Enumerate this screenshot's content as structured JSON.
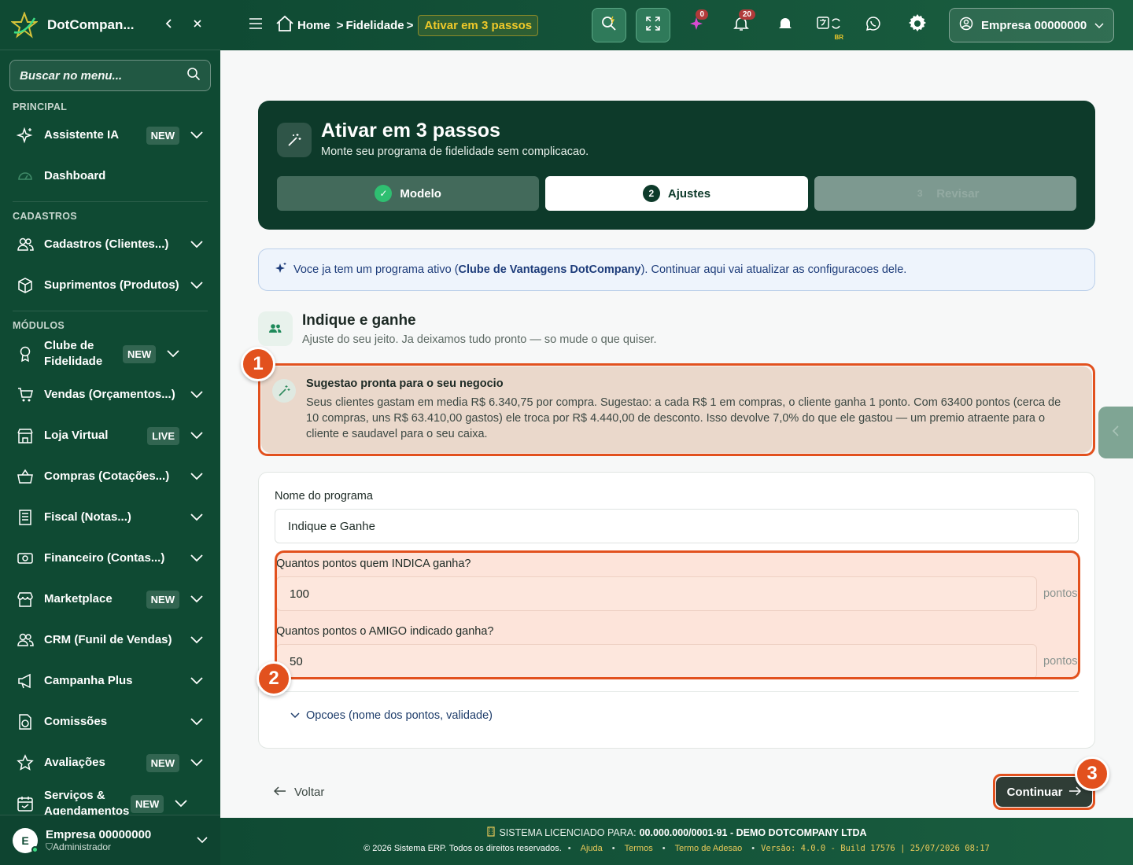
{
  "sidebar": {
    "brand": "DotCompan...",
    "search_placeholder": "Buscar no menu...",
    "sections": {
      "principal": "PRINCIPAL",
      "cadastros": "CADASTROS",
      "modulos": "MÓDULOS"
    },
    "items": [
      {
        "label": "Assistente IA",
        "badge": "NEW",
        "icon": "sparkle-icon"
      },
      {
        "label": "Dashboard",
        "badge": "",
        "icon": "gauge-icon"
      },
      {
        "label": "Cadastros (Clientes...)",
        "badge": "",
        "icon": "users-icon"
      },
      {
        "label": "Suprimentos (Produtos)",
        "badge": "",
        "icon": "box-icon"
      },
      {
        "label": "Clube de Fidelidade",
        "badge": "NEW",
        "icon": "award-icon"
      },
      {
        "label": "Vendas (Orçamentos...)",
        "badge": "",
        "icon": "cart-icon"
      },
      {
        "label": "Loja Virtual",
        "badge": "LIVE",
        "icon": "store-icon"
      },
      {
        "label": "Compras (Cotações...)",
        "badge": "",
        "icon": "basket-icon"
      },
      {
        "label": "Fiscal (Notas...)",
        "badge": "",
        "icon": "document-icon"
      },
      {
        "label": "Financeiro (Contas...)",
        "badge": "",
        "icon": "cash-icon"
      },
      {
        "label": "Marketplace",
        "badge": "NEW",
        "icon": "shop-icon"
      },
      {
        "label": "CRM (Funil de Vendas)",
        "badge": "",
        "icon": "people-icon"
      },
      {
        "label": "Campanha Plus",
        "badge": "",
        "icon": "megaphone-icon"
      },
      {
        "label": "Comissões",
        "badge": "",
        "icon": "commission-icon"
      },
      {
        "label": "Avaliações",
        "badge": "NEW",
        "icon": "star-icon"
      },
      {
        "label": "Serviços & Agendamentos",
        "badge": "NEW",
        "icon": "calendar-icon"
      }
    ],
    "user": {
      "initial": "E",
      "name": "Empresa 00000000",
      "role": "Administrador"
    }
  },
  "header": {
    "breadcrumb": [
      "Home",
      "Fidelidade",
      "Ativar em 3 passos"
    ],
    "notif_counts": {
      "ai": "0",
      "bell": "20"
    },
    "flag_label": "BR",
    "company": "Empresa 00000000"
  },
  "hero": {
    "title": "Ativar em 3 passos",
    "subtitle": "Monte seu programa de fidelidade sem complicacao.",
    "steps": [
      {
        "num": "✓",
        "label": "Modelo",
        "state": "done"
      },
      {
        "num": "2",
        "label": "Ajustes",
        "state": "current"
      },
      {
        "num": "3",
        "label": "Revisar",
        "state": "next"
      }
    ]
  },
  "info": {
    "prefix": "Voce ja tem um programa ativo (",
    "program": "Clube de Vantagens DotCompany",
    "suffix": "). Continuar aqui vai atualizar as configuracoes dele."
  },
  "section": {
    "title": "Indique e ganhe",
    "subtitle": "Ajuste do seu jeito. Ja deixamos tudo pronto — so mude o que quiser."
  },
  "suggestion": {
    "title": "Sugestao pronta para o seu negocio",
    "text": "Seus clientes gastam em media R$ 6.340,75 por compra. Sugestao: a cada R$ 1 em compras, o cliente ganha 1 ponto. Com 63400 pontos (cerca de 10 compras, uns R$ 63.410,00 gastos) ele troca por R$ 4.440,00 de desconto. Isso devolve 7,0% do que ele gastou — um premio atraente para o cliente e saudavel para o seu caixa."
  },
  "form": {
    "name_label": "Nome do programa",
    "name_value": "Indique e Ganhe",
    "referrer_label": "Quantos pontos quem INDICA ganha?",
    "referrer_value": "100",
    "friend_label": "Quantos pontos o AMIGO indicado ganha?",
    "friend_value": "50",
    "unit": "pontos",
    "options_label": "Opcoes (nome dos pontos, validade)"
  },
  "markers": [
    "1",
    "2",
    "3"
  ],
  "actions": {
    "back": "Voltar",
    "continue": "Continuar"
  },
  "footer": {
    "license_prefix": "SISTEMA LICENCIADO PARA:",
    "license_value": "00.000.000/0001-91 - DEMO DOTCOMPANY LTDA",
    "copyright": "© 2026 Sistema ERP. Todos os direitos reservados.",
    "links": [
      "Ajuda",
      "Termos",
      "Termo de Adesao"
    ],
    "version": "Versão: 4.0.0 - Build 17576 | 25/07/2026 08:17"
  },
  "colors": {
    "sidebar": "#0f4a33",
    "accent_orange": "#e2511e",
    "hero": "#0d3a2a"
  }
}
